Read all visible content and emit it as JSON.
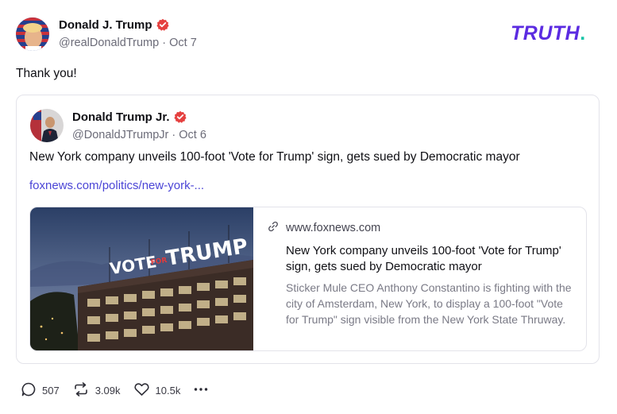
{
  "post": {
    "author_name": "Donald J. Trump",
    "author_handle": "@realDonaldTrump",
    "date": "Oct 7",
    "text": "Thank you!"
  },
  "brand": {
    "logo_text": "TRUTH",
    "logo_dot": ".",
    "accent": "#5b2be1",
    "dot_color": "#17c5a8"
  },
  "quote": {
    "author_name": "Donald Trump Jr.",
    "author_handle": "@DonaldJTrumpJr",
    "date": "Oct 6",
    "text": "New York company unveils 100-foot 'Vote for Trump' sign, gets sued by Democratic mayor",
    "link": "foxnews.com/politics/new-york-...",
    "preview": {
      "domain": "www.foxnews.com",
      "title": "New York company unveils 100-foot 'Vote for Trump' sign, gets sued by Democratic mayor",
      "description": "Sticker Mule CEO Anthony Constantino is fighting with the city of Amsterdam, New York, to display a 100-foot \"Vote for Trump\" sign visible from the New York State Thruway.",
      "image_sign_vote": "VOTE",
      "image_sign_for": "FOR",
      "image_sign_trump": "TRUMP"
    }
  },
  "actions": {
    "replies": "507",
    "reposts": "3.09k",
    "likes": "10.5k"
  },
  "icons": {
    "verified": "verified-badge-icon",
    "link": "link-icon",
    "reply": "reply-icon",
    "repost": "repost-icon",
    "like": "heart-icon",
    "more": "more-icon"
  },
  "colors": {
    "verified": "#e5403f",
    "link_text": "#4b45d6"
  }
}
